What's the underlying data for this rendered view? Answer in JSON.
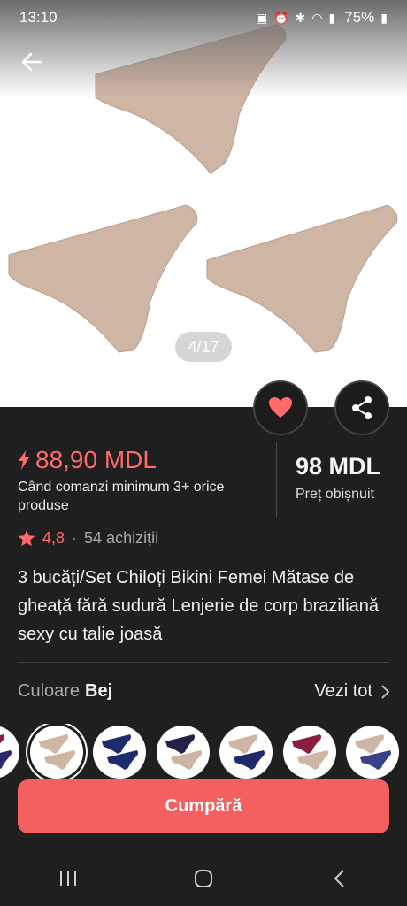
{
  "status_bar": {
    "time": "13:10",
    "battery": "75%"
  },
  "gallery": {
    "counter": "4/17",
    "product_color": "#cfb5a4"
  },
  "pricing": {
    "sale_price": "88,90 MDL",
    "sale_condition": "Când comanzi minimum 3+ orice produse",
    "regular_price": "98 MDL",
    "regular_label": "Preț obișnuit",
    "accent_color": "#ff6b6b"
  },
  "rating": {
    "score": "4,8",
    "separator": "·",
    "purchases": "54 achiziții"
  },
  "product": {
    "title": "3 bucăți/Set Chiloți Bikini Femei Mătase de gheață fără sudură Lenjerie de corp braziliană sexy cu talie joasă"
  },
  "variants": {
    "label": "Culoare",
    "selected": "Bej",
    "see_all": "Vezi tot",
    "swatch_colors": [
      [
        "#8b1d3f",
        "#2a2a6a"
      ],
      [
        "#cfb5a4",
        "#cfb5a4"
      ],
      [
        "#1e2a6b",
        "#1e2a6b"
      ],
      [
        "#222244",
        "#cfb5a4"
      ],
      [
        "#cfb5a4",
        "#1e2a6b"
      ],
      [
        "#8b1d3f",
        "#cfb5a4"
      ],
      [
        "#cfb5a4",
        "#3b3f8a"
      ]
    ]
  },
  "actions": {
    "buy_label": "Cumpără"
  }
}
